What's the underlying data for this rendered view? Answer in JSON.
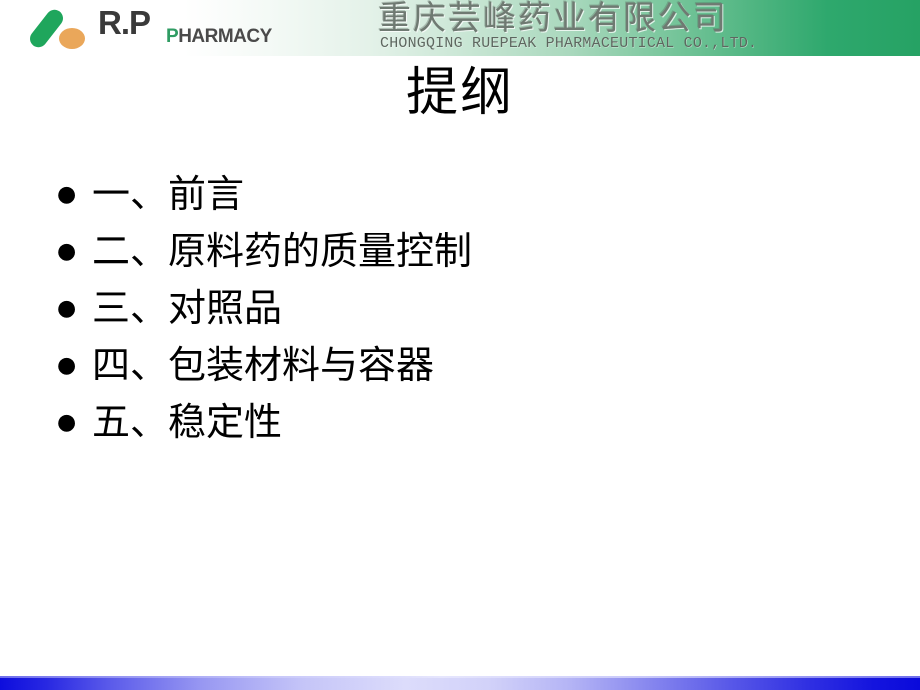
{
  "slide": {
    "title": "提纲",
    "background_color": "#ffffff"
  },
  "header": {
    "band_gradient_from": "#ffffff",
    "band_gradient_to": "#26a264",
    "logo": {
      "brand_text": "R.P",
      "brand_sub_first": "P",
      "brand_sub_rest": "HARMACY",
      "capsule_color": "#1fa65c",
      "dot_color": "#eaa75a",
      "accent_color": "#2f9c63"
    },
    "company_name_cn": "重庆芸峰药业有限公司",
    "company_name_en": "CHONGQING RUEPEAK PHARMACEUTICAL CO.,LTD."
  },
  "outline": {
    "bullet_glyph": "●",
    "items": [
      {
        "label": "一、前言"
      },
      {
        "label": "二、原料药的质量控制"
      },
      {
        "label": "三、对照品"
      },
      {
        "label": "四、包装材料与容器"
      },
      {
        "label": "五、稳定性"
      }
    ]
  },
  "footer": {
    "accent_color": "#0d0ddd"
  }
}
